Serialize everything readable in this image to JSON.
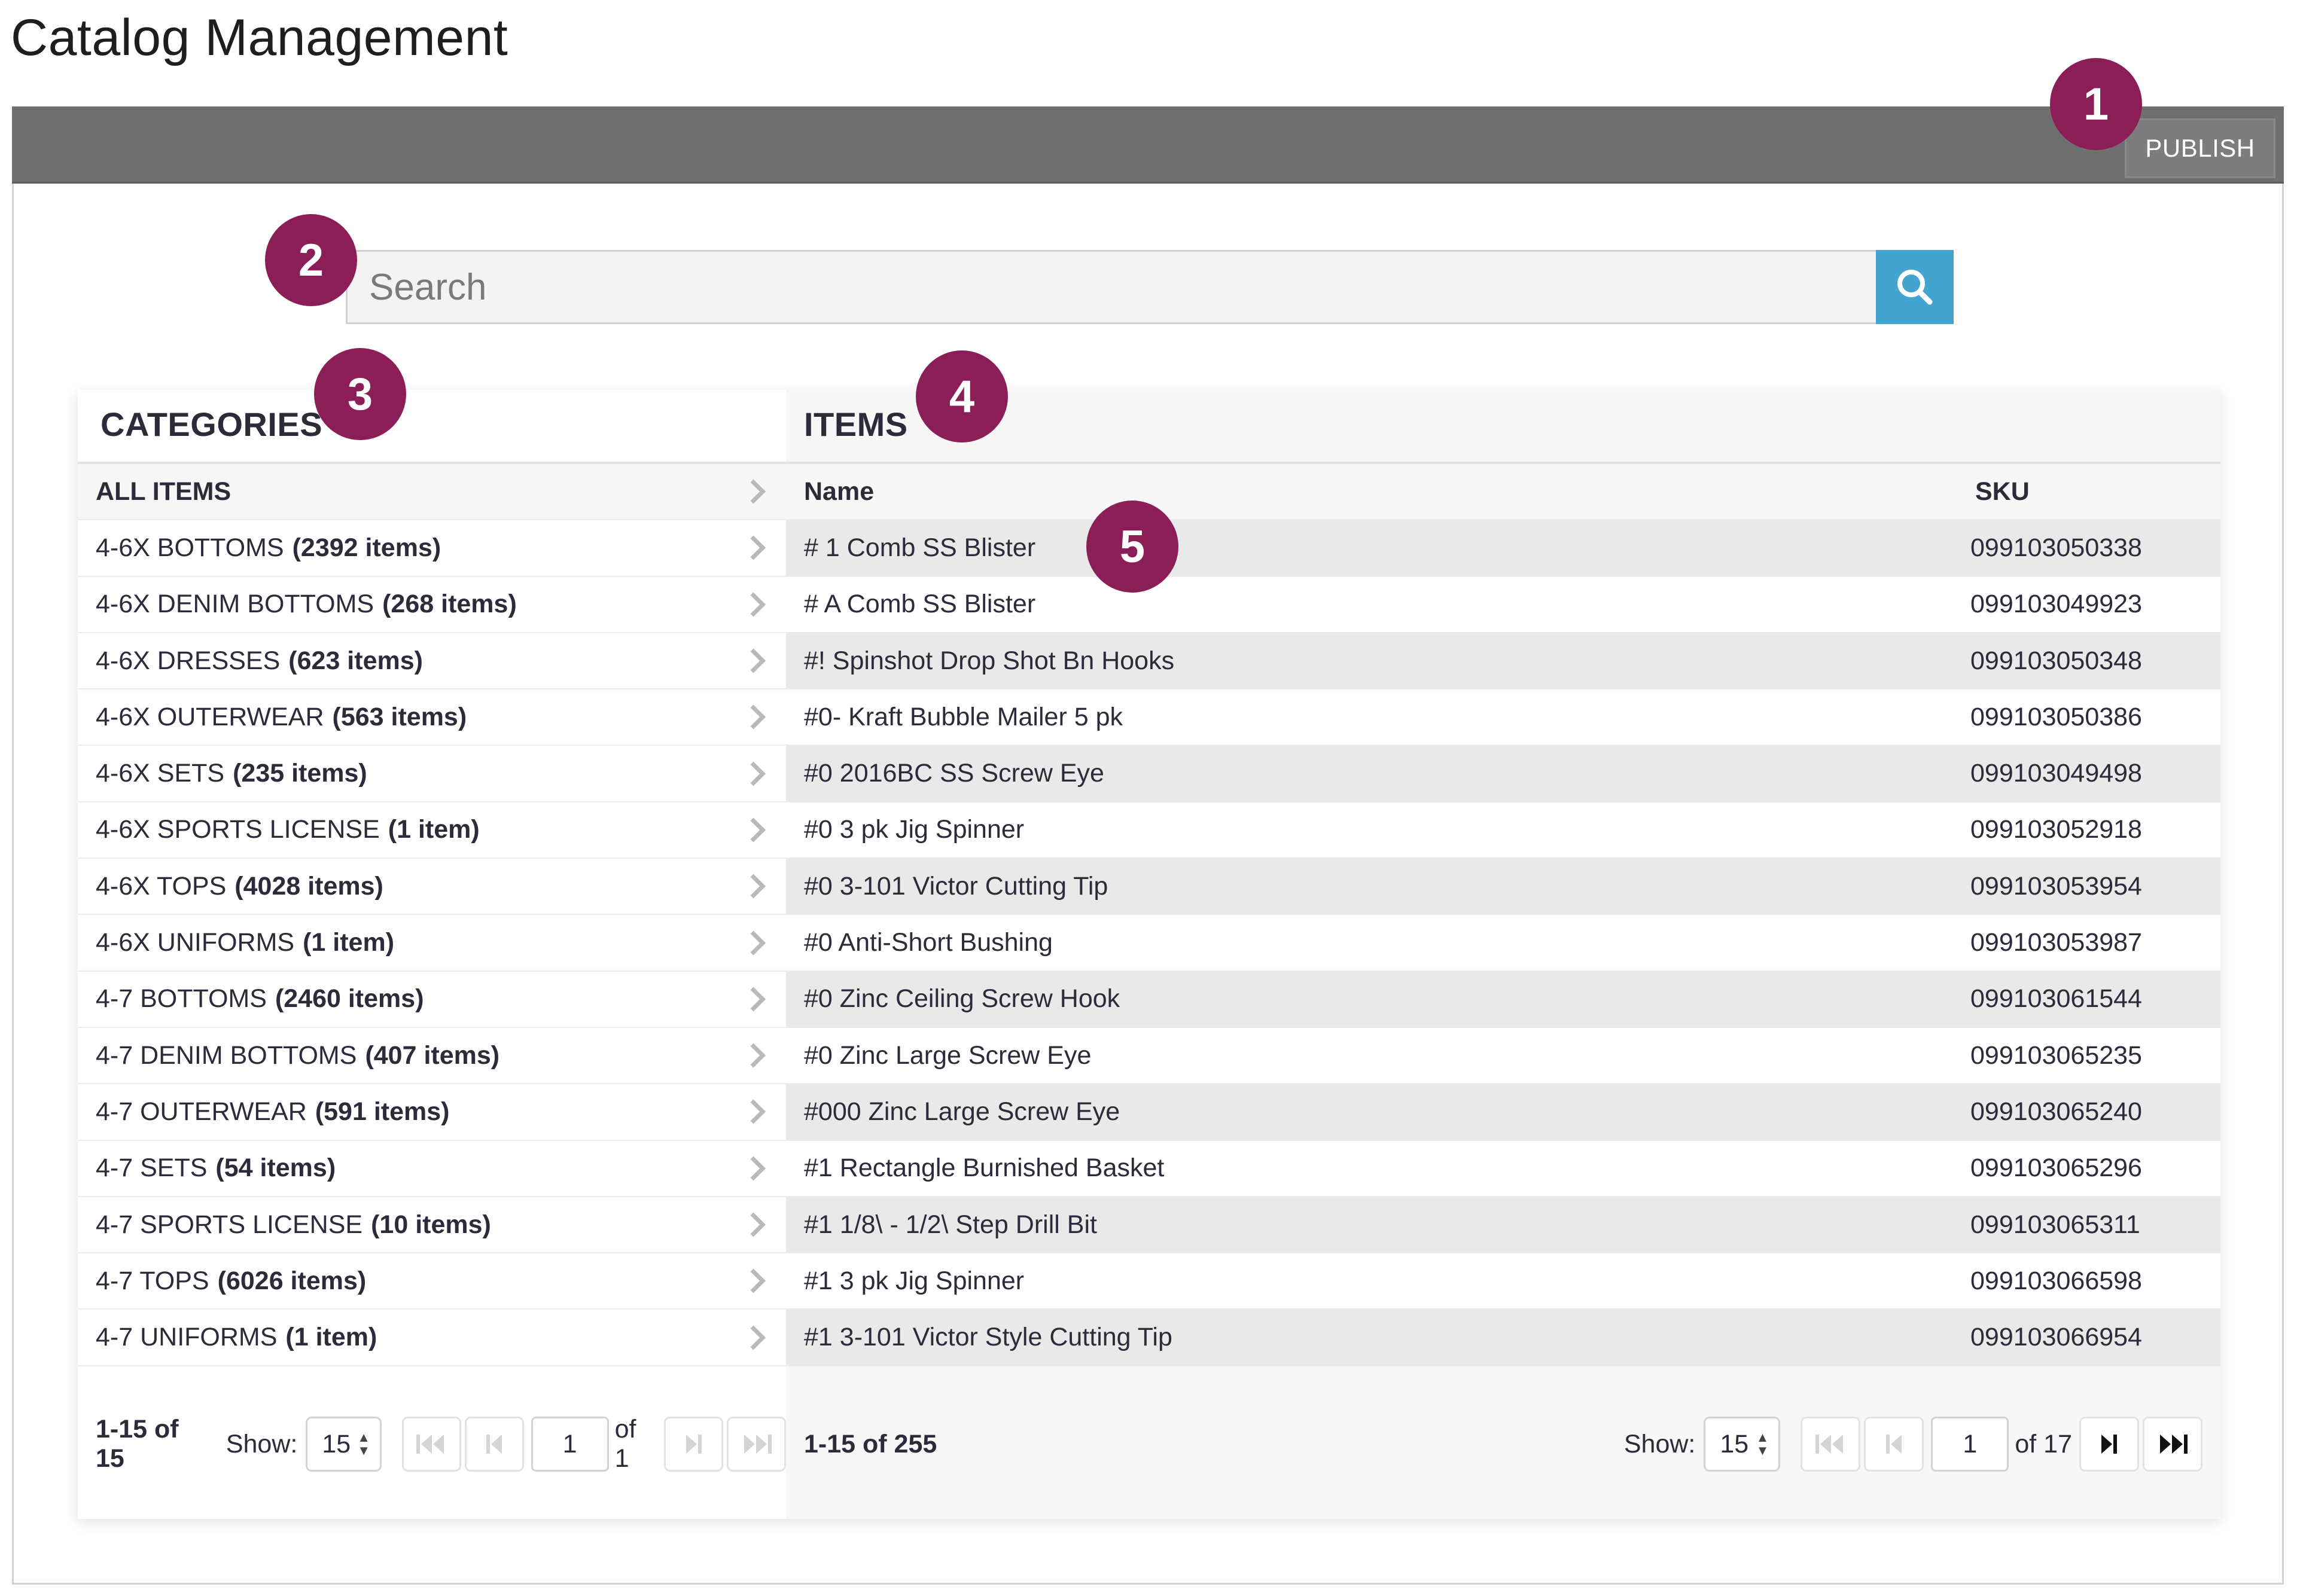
{
  "page_title": "Catalog Management",
  "toolbar": {
    "publish_label": "PUBLISH"
  },
  "callouts": [
    "1",
    "2",
    "3",
    "4",
    "5"
  ],
  "search": {
    "placeholder": "Search",
    "icon": "search-icon"
  },
  "colors": {
    "callout": "#8b1e56",
    "toolbar": "#6f6f6f",
    "search_button": "#42a4cf"
  },
  "categories": {
    "header": "CATEGORIES",
    "all_items": "ALL ITEMS",
    "rows": [
      {
        "name": "4-6X BOTTOMS",
        "count": "(2392 items)"
      },
      {
        "name": "4-6X DENIM BOTTOMS",
        "count": "(268 items)"
      },
      {
        "name": "4-6X DRESSES",
        "count": "(623 items)"
      },
      {
        "name": "4-6X OUTERWEAR",
        "count": "(563 items)"
      },
      {
        "name": "4-6X SETS",
        "count": "(235 items)"
      },
      {
        "name": "4-6X SPORTS LICENSE",
        "count": "(1 item)"
      },
      {
        "name": "4-6X TOPS",
        "count": "(4028 items)"
      },
      {
        "name": "4-6X UNIFORMS",
        "count": "(1 item)"
      },
      {
        "name": "4-7 BOTTOMS",
        "count": "(2460 items)"
      },
      {
        "name": "4-7 DENIM BOTTOMS",
        "count": "(407 items)"
      },
      {
        "name": "4-7 OUTERWEAR",
        "count": "(591 items)"
      },
      {
        "name": "4-7 SETS",
        "count": "(54 items)"
      },
      {
        "name": "4-7 SPORTS LICENSE",
        "count": "(10 items)"
      },
      {
        "name": "4-7 TOPS",
        "count": "(6026 items)"
      },
      {
        "name": "4-7 UNIFORMS",
        "count": "(1 item)"
      }
    ],
    "footer": {
      "range": "1-15 of 15",
      "show_label": "Show:",
      "show_value": "15",
      "page": "1",
      "of_pages": "of 1"
    }
  },
  "items": {
    "header": "ITEMS",
    "columns": {
      "name": "Name",
      "sku": "SKU"
    },
    "rows": [
      {
        "name": "# 1 Comb SS Blister",
        "sku": "099103050338"
      },
      {
        "name": "# A Comb SS Blister",
        "sku": "099103049923"
      },
      {
        "name": "#! Spinshot Drop Shot Bn Hooks",
        "sku": "099103050348"
      },
      {
        "name": "#0- Kraft Bubble Mailer 5 pk",
        "sku": "099103050386"
      },
      {
        "name": "#0 2016BC SS Screw Eye",
        "sku": "099103049498"
      },
      {
        "name": "#0 3 pk Jig Spinner",
        "sku": "099103052918"
      },
      {
        "name": "#0 3-101 Victor Cutting Tip",
        "sku": "099103053954"
      },
      {
        "name": "#0 Anti-Short Bushing",
        "sku": "099103053987"
      },
      {
        "name": "#0 Zinc Ceiling Screw Hook",
        "sku": "099103061544"
      },
      {
        "name": "#0 Zinc Large Screw Eye",
        "sku": "099103065235"
      },
      {
        "name": "#000 Zinc Large Screw Eye",
        "sku": "099103065240"
      },
      {
        "name": "#1 Rectangle Burnished Basket",
        "sku": "099103065296"
      },
      {
        "name": "#1 1/8\\ - 1/2\\ Step Drill Bit",
        "sku": "099103065311"
      },
      {
        "name": "#1 3 pk Jig Spinner",
        "sku": "099103066598"
      },
      {
        "name": "#1 3-101 Victor Style Cutting Tip",
        "sku": "099103066954"
      }
    ],
    "footer": {
      "range": "1-15 of 255",
      "show_label": "Show:",
      "show_value": "15",
      "page": "1",
      "of_pages": "of 17"
    }
  }
}
